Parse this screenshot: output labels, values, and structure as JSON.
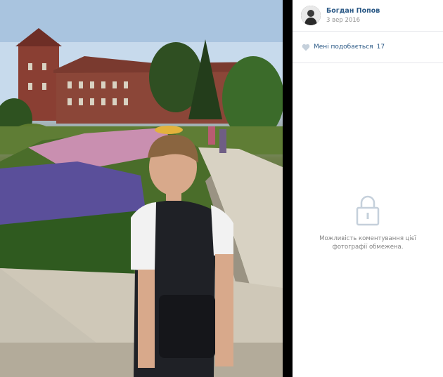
{
  "post": {
    "author_name": "Богдан Попов",
    "date": "3 вер 2016",
    "likes_label": "Мені подобається",
    "likes_count": "17",
    "comments_restricted_text": "Можливість коментування цієї фотографії обмежена."
  },
  "icons": {
    "like": "heart-icon",
    "lock": "lock-icon"
  },
  "colors": {
    "link": "#2a5885",
    "muted": "#939393",
    "icon": "#c5d0db"
  }
}
